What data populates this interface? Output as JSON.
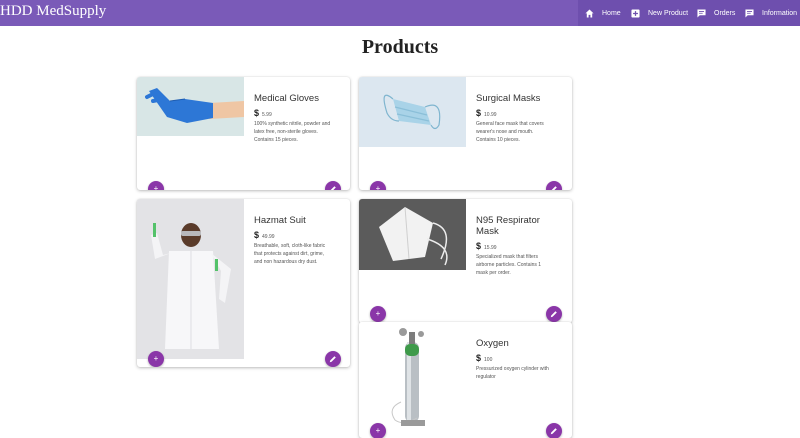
{
  "header": {
    "brand": "HDD MedSupply",
    "nav": [
      {
        "label": "Home",
        "icon": "home-icon"
      },
      {
        "label": "New Product",
        "icon": "add-box-icon"
      },
      {
        "label": "Orders",
        "icon": "chat-icon"
      },
      {
        "label": "Information",
        "icon": "chat-icon"
      }
    ]
  },
  "page": {
    "title": "Products"
  },
  "products": [
    {
      "name": "Medical Gloves",
      "price": "5.99",
      "description": "100% synthetic nitrile, powder and latex free, non-sterile gloves. Contains 15 pieces."
    },
    {
      "name": "Surgical Masks",
      "price": "10.99",
      "description": "General face mask that covers wearer's nose and mouth. Contains 10 pieces."
    },
    {
      "name": "Hazmat Suit",
      "price": "49.99",
      "description": "Breathable, soft, cloth-like fabric that protects against dirt, grime, and non hazardous dry dust."
    },
    {
      "name": "N95 Respirator Mask",
      "price": "15.99",
      "description": "Specialized mask that filters airborne particles. Contains 1 mask per order."
    },
    {
      "name": "Oxygen",
      "price": "100",
      "description": "Pressurized oxygen cylinder with regulator"
    }
  ],
  "actions": {
    "add_symbol": "+"
  },
  "colors": {
    "nav_bar": "#7a5ab8",
    "fab": "#8a36a8"
  }
}
